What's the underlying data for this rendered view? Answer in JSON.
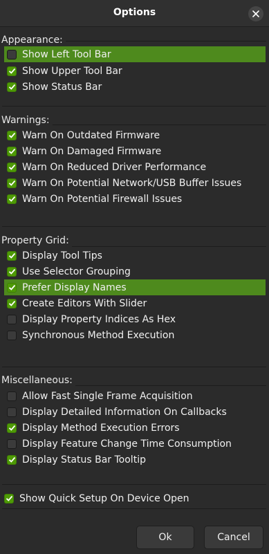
{
  "dialog": {
    "title": "Options"
  },
  "sections": {
    "appearance": {
      "title": "Appearance:",
      "items": [
        {
          "label": "Show Left Tool Bar",
          "checked": false
        },
        {
          "label": "Show Upper Tool Bar",
          "checked": true
        },
        {
          "label": "Show Status Bar",
          "checked": true
        }
      ]
    },
    "warnings": {
      "title": "Warnings:",
      "items": [
        {
          "label": "Warn On Outdated Firmware",
          "checked": true
        },
        {
          "label": "Warn On Damaged Firmware",
          "checked": true
        },
        {
          "label": "Warn On Reduced Driver Performance",
          "checked": true
        },
        {
          "label": "Warn On Potential Network/USB Buffer Issues",
          "checked": true
        },
        {
          "label": "Warn On Potential Firewall Issues",
          "checked": true
        }
      ]
    },
    "property_grid": {
      "title": "Property Grid:",
      "items": [
        {
          "label": "Display Tool Tips",
          "checked": true
        },
        {
          "label": "Use Selector Grouping",
          "checked": true
        },
        {
          "label": "Prefer Display Names",
          "checked": true
        },
        {
          "label": "Create Editors With Slider",
          "checked": true
        },
        {
          "label": "Display Property Indices As Hex",
          "checked": false
        },
        {
          "label": "Synchronous Method Execution",
          "checked": false
        }
      ]
    },
    "miscellaneous": {
      "title": "Miscellaneous:",
      "items": [
        {
          "label": "Allow Fast Single Frame Acquisition",
          "checked": false
        },
        {
          "label": "Display Detailed Information On Callbacks",
          "checked": false
        },
        {
          "label": "Display Method Execution Errors",
          "checked": true
        },
        {
          "label": "Display Feature Change Time Consumption",
          "checked": false
        },
        {
          "label": "Display Status Bar Tooltip",
          "checked": true
        }
      ]
    }
  },
  "quick_setup": {
    "label": "Show Quick Setup On Device Open",
    "checked": true
  },
  "buttons": {
    "ok": "Ok",
    "cancel": "Cancel"
  },
  "colors": {
    "highlight": "#4e8a1d",
    "check_on": "#4e9a06",
    "background": "#2b2b2b"
  }
}
